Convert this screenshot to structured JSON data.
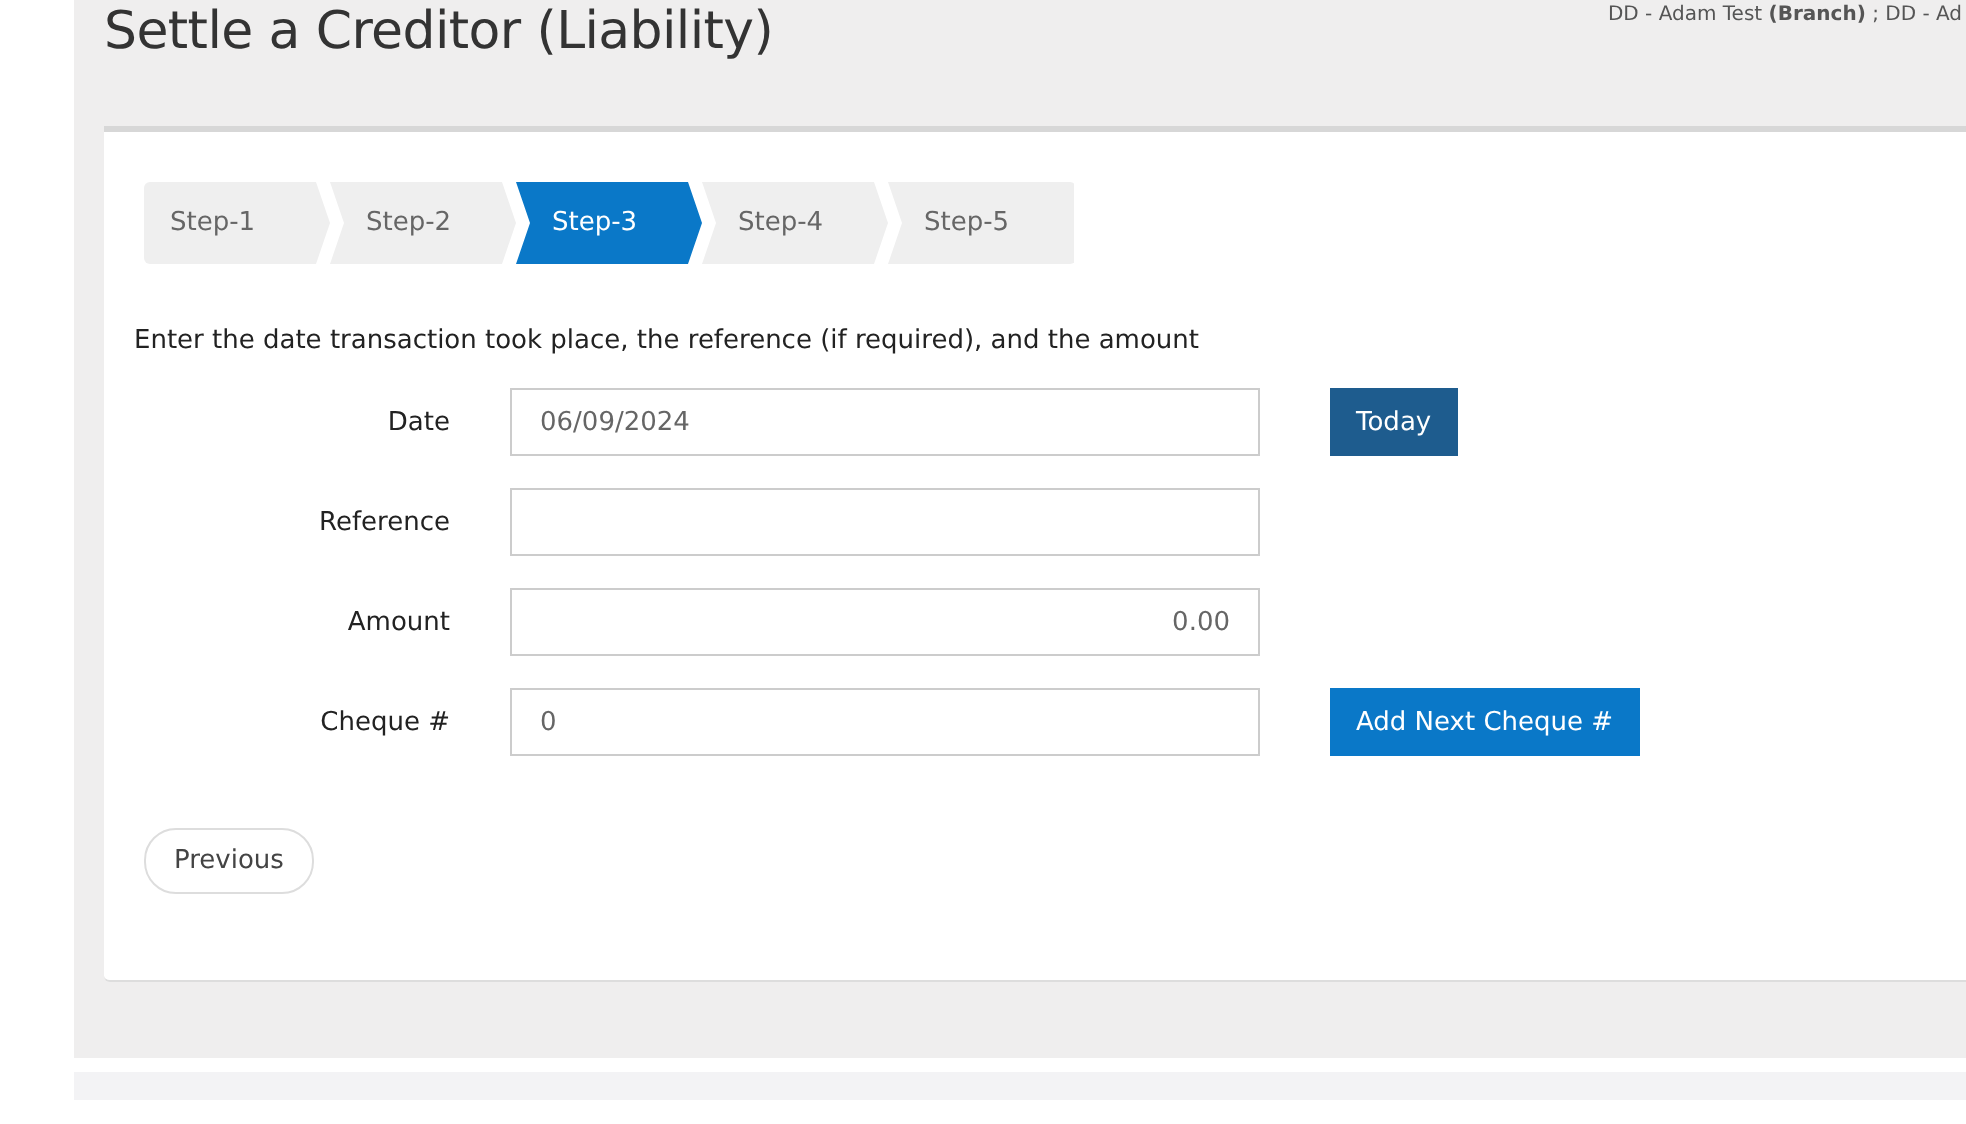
{
  "page": {
    "title": "Settle a Creditor (Liability)",
    "user_info": "DD - Adam Test **(Branch)** ; DD - Ad"
  },
  "steps": [
    {
      "label": "Step-1",
      "selected": false
    },
    {
      "label": "Step-2",
      "selected": false
    },
    {
      "label": "Step-3",
      "selected": true
    },
    {
      "label": "Step-4",
      "selected": false
    },
    {
      "label": "Step-5",
      "selected": false
    }
  ],
  "instructions": "Enter the date transaction took place, the reference (if required), and the amount",
  "fields": [
    {
      "label": "Date",
      "value": "06/09/2024",
      "kind": "text",
      "button": {
        "label": "Today",
        "kind": "dark"
      }
    },
    {
      "label": "Reference",
      "kind": "text"
    },
    {
      "label": "Amount",
      "value": "0.00",
      "kind": "number"
    },
    {
      "label": "Cheque #",
      "value": "0",
      "kind": "text",
      "button": {
        "label": "Add Next Cheque #",
        "kind": "primary"
      }
    }
  ],
  "buttons": [
    {
      "label": "Previous"
    }
  ]
}
